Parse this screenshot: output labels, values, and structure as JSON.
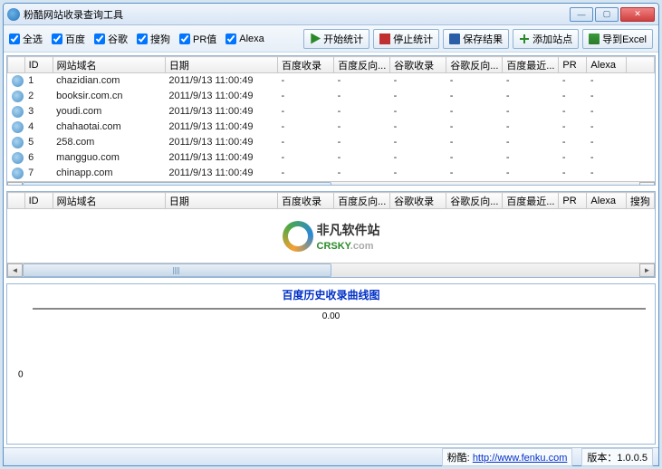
{
  "window": {
    "title": "粉酷网站收录查询工具"
  },
  "checkboxes": {
    "selectAll": "全选",
    "baidu": "百度",
    "google": "谷歌",
    "sogou": "搜狗",
    "pr": "PR值",
    "alexa": "Alexa"
  },
  "buttons": {
    "start": "开始统计",
    "stop": "停止统计",
    "save": "保存结果",
    "addSite": "添加站点",
    "export": "导到Excel"
  },
  "columns": {
    "id": "ID",
    "domain": "网站域名",
    "date": "日期",
    "baiduIndex": "百度收录",
    "baiduBack": "百度反向...",
    "googleIndex": "谷歌收录",
    "googleBack": "谷歌反向...",
    "baiduRecent": "百度最近...",
    "pr": "PR",
    "alexa": "Alexa",
    "sogou": "搜狗"
  },
  "rows": [
    {
      "id": "1",
      "domain": "chazidian.com",
      "date": "2011/9/13 11:00:49"
    },
    {
      "id": "2",
      "domain": "booksir.com.cn",
      "date": "2011/9/13 11:00:49"
    },
    {
      "id": "3",
      "domain": "youdi.com",
      "date": "2011/9/13 11:00:49"
    },
    {
      "id": "4",
      "domain": "chahaotai.com",
      "date": "2011/9/13 11:00:49"
    },
    {
      "id": "5",
      "domain": "258.com",
      "date": "2011/9/13 11:00:49"
    },
    {
      "id": "6",
      "domain": "mangguo.com",
      "date": "2011/9/13 11:00:49"
    },
    {
      "id": "7",
      "domain": "chinapp.com",
      "date": "2011/9/13 11:00:49"
    }
  ],
  "logo": {
    "cn": "非凡软件站",
    "en": "CRSKY",
    "suffix": ".com"
  },
  "chart_data": {
    "type": "line",
    "title": "百度历史收录曲线图",
    "x": [
      0.0
    ],
    "values": [
      0
    ],
    "xlabel": "0.00",
    "ylabel": "0",
    "xlim": [
      0,
      1
    ],
    "ylim": [
      -1,
      1
    ]
  },
  "status": {
    "brand": "粉酷:",
    "url": "http://www.fenku.com",
    "verLabel": "版本：",
    "ver": "1.0.0.5"
  }
}
